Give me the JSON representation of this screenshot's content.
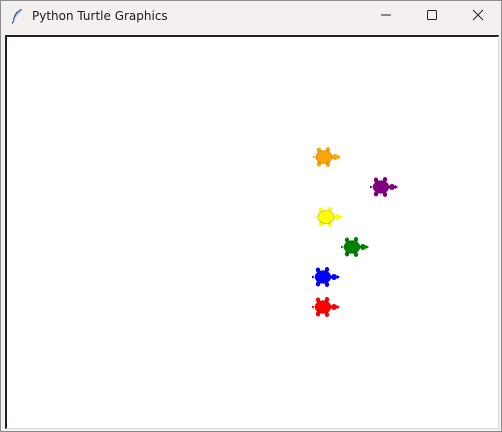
{
  "window": {
    "title": "Python Turtle Graphics",
    "icon": "feather-pen-icon",
    "controls": {
      "minimize_icon": "minimize-icon",
      "maximize_icon": "maximize-icon",
      "close_icon": "close-icon"
    }
  },
  "canvas": {
    "background": "#ffffff",
    "turtles": [
      {
        "color": "orange",
        "hex": "#ffa500",
        "heading": "east"
      },
      {
        "color": "purple",
        "hex": "#800080",
        "heading": "east"
      },
      {
        "color": "yellow",
        "hex": "#ffff00",
        "heading": "east"
      },
      {
        "color": "green",
        "hex": "#008000",
        "heading": "east"
      },
      {
        "color": "blue",
        "hex": "#0000ff",
        "heading": "east"
      },
      {
        "color": "red",
        "hex": "#ff0000",
        "heading": "east"
      }
    ]
  }
}
